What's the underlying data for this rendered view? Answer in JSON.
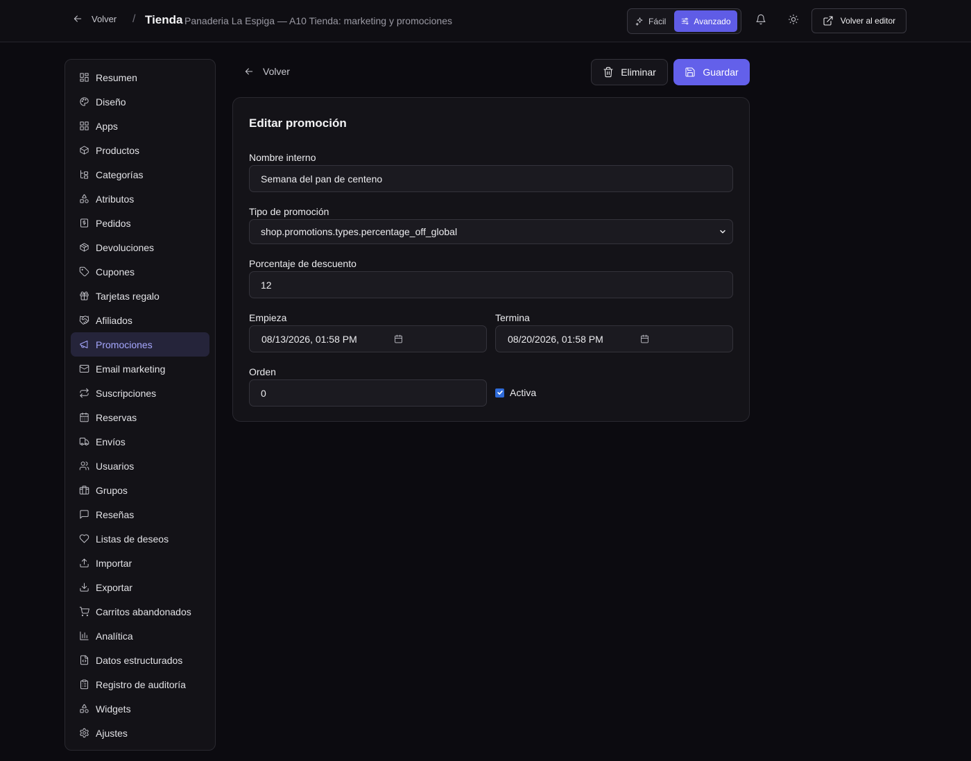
{
  "header": {
    "back_label": "Volver",
    "separator": "/",
    "title": "Tienda",
    "subtitle": "Panaderia La Espiga — A10 Tienda: marketing y promociones",
    "mode_easy": "Fácil",
    "mode_advanced": "Avanzado",
    "mode_selected": "Avanzado",
    "editor_label": "Volver al editor"
  },
  "sidebar": {
    "active": "Promociones",
    "items": [
      {
        "label": "Resumen",
        "icon": "dashboard-icon"
      },
      {
        "label": "Diseño",
        "icon": "palette-icon"
      },
      {
        "label": "Apps",
        "icon": "apps-icon"
      },
      {
        "label": "Productos",
        "icon": "box-icon"
      },
      {
        "label": "Categorías",
        "icon": "tree-icon"
      },
      {
        "label": "Atributos",
        "icon": "shapes-icon"
      },
      {
        "label": "Pedidos",
        "icon": "receipt-icon"
      },
      {
        "label": "Devoluciones",
        "icon": "package-return-icon"
      },
      {
        "label": "Cupones",
        "icon": "tag-icon"
      },
      {
        "label": "Tarjetas regalo",
        "icon": "gift-icon"
      },
      {
        "label": "Afiliados",
        "icon": "handshake-icon"
      },
      {
        "label": "Promociones",
        "icon": "megaphone-icon"
      },
      {
        "label": "Email marketing",
        "icon": "mail-icon"
      },
      {
        "label": "Suscripciones",
        "icon": "repeat-icon"
      },
      {
        "label": "Reservas",
        "icon": "calendar-icon"
      },
      {
        "label": "Envíos",
        "icon": "truck-icon"
      },
      {
        "label": "Usuarios",
        "icon": "users-icon"
      },
      {
        "label": "Grupos",
        "icon": "building-icon"
      },
      {
        "label": "Reseñas",
        "icon": "message-icon"
      },
      {
        "label": "Listas de deseos",
        "icon": "heart-icon"
      },
      {
        "label": "Importar",
        "icon": "upload-icon"
      },
      {
        "label": "Exportar",
        "icon": "download-icon"
      },
      {
        "label": "Carritos abandonados",
        "icon": "cart-icon"
      },
      {
        "label": "Analítica",
        "icon": "bar-chart-icon"
      },
      {
        "label": "Datos estructurados",
        "icon": "file-code-icon"
      },
      {
        "label": "Registro de auditoría",
        "icon": "clipboard-icon"
      },
      {
        "label": "Widgets",
        "icon": "widgets-icon"
      },
      {
        "label": "Ajustes",
        "icon": "gear-icon"
      }
    ]
  },
  "main": {
    "back_label": "Volver",
    "delete_label": "Eliminar",
    "save_label": "Guardar",
    "card_title": "Editar promoción",
    "fields": {
      "name_label": "Nombre interno",
      "name_value": "Semana del pan de centeno",
      "type_label": "Tipo de promoción",
      "type_value": "shop.promotions.types.percentage_off_global",
      "percent_label": "Porcentaje de descuento",
      "percent_value": "12",
      "start_label": "Empieza",
      "start_value": "08/13/2026, 01:58 PM",
      "end_label": "Termina",
      "end_value": "08/20/2026, 01:58 PM",
      "order_label": "Orden",
      "order_value": "0",
      "active_label": "Activa",
      "active_checked": true
    }
  },
  "colors": {
    "accent": "#6360ea",
    "active_nav_bg": "#25243a",
    "active_nav_text": "#a6a8ff",
    "background": "#0c0b10"
  }
}
